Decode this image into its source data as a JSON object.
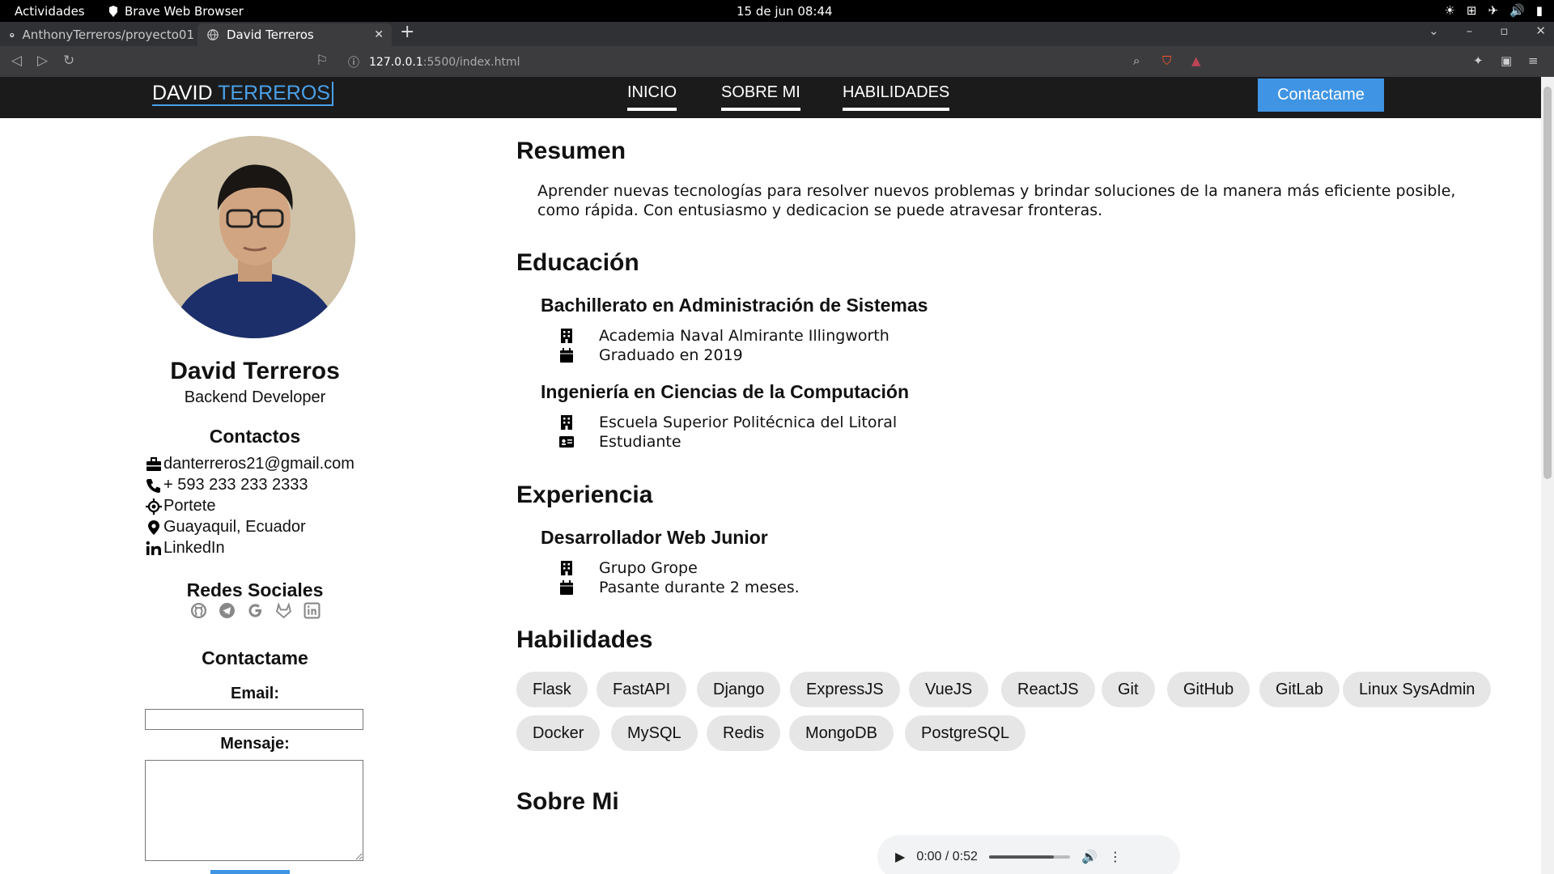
{
  "os_bar": {
    "activities": "Actividades",
    "app_name": "Brave Web Browser",
    "clock": "15 de jun  08:44"
  },
  "browser": {
    "tabs": [
      {
        "title": "AnthonyTerreros/proyecto01",
        "active": false
      },
      {
        "title": "David Terreros",
        "active": true
      }
    ],
    "url_host": "127.0.0.1",
    "url_path": ":5500/index.html"
  },
  "site_nav": {
    "brand_first": "DAVID",
    "brand_second": "TERREROS",
    "links": [
      "INICIO",
      "SOBRE MI",
      "HABILIDADES"
    ],
    "cta": "Contactame"
  },
  "profile": {
    "name": "David Terreros",
    "role": "Backend Developer",
    "contacts_title": "Contactos",
    "contacts": [
      {
        "icon": "briefcase-icon",
        "text": "danterreros21@gmail.com"
      },
      {
        "icon": "phone-icon",
        "text": "+ 593 233 233 2333"
      },
      {
        "icon": "location-crosshair-icon",
        "text": "Portete"
      },
      {
        "icon": "map-pin-icon",
        "text": "Guayaquil, Ecuador"
      },
      {
        "icon": "linkedin-icon",
        "text": "LinkedIn"
      }
    ],
    "social_title": "Redes Sociales",
    "social": [
      "github-icon",
      "telegram-icon",
      "google-icon",
      "gitlab-icon",
      "linkedin-icon"
    ],
    "form_title": "Contactame",
    "email_label": "Email:",
    "message_label": "Mensaje:"
  },
  "resume": {
    "summary_title": "Resumen",
    "summary": "Aprender nuevas tecnologías para resolver nuevos problemas y brindar soluciones de la manera más eficiente posible, como rápida. Con entusiasmo y dedicacion se puede atravesar fronteras.",
    "education_title": "Educación",
    "education": [
      {
        "degree": "Bachillerato en Administración de Sistemas",
        "institution": "Academia Naval Almirante Illingworth",
        "status": "Graduado en 2019",
        "status_icon": "calendar-icon"
      },
      {
        "degree": "Ingeniería en Ciencias de la Computación",
        "institution": "Escuela Superior Politécnica del Litoral",
        "status": "Estudiante",
        "status_icon": "id-card-icon"
      }
    ],
    "experience_title": "Experiencia",
    "experience": [
      {
        "position": "Desarrollador Web Junior",
        "company": "Grupo Grope",
        "detail": "Pasante durante 2 meses."
      }
    ],
    "skills_title": "Habilidades",
    "skills": [
      "Flask",
      "FastAPI",
      "Django",
      "ExpressJS",
      "VueJS",
      "ReactJS",
      "Git",
      "GitHub",
      "GitLab",
      "Linux SysAdmin",
      "Docker",
      "MySQL",
      "Redis",
      "MongoDB",
      "PostgreSQL"
    ],
    "about_title": "Sobre Mi",
    "audio_time": "0:00 / 0:52",
    "audio_progress": 0.8
  }
}
